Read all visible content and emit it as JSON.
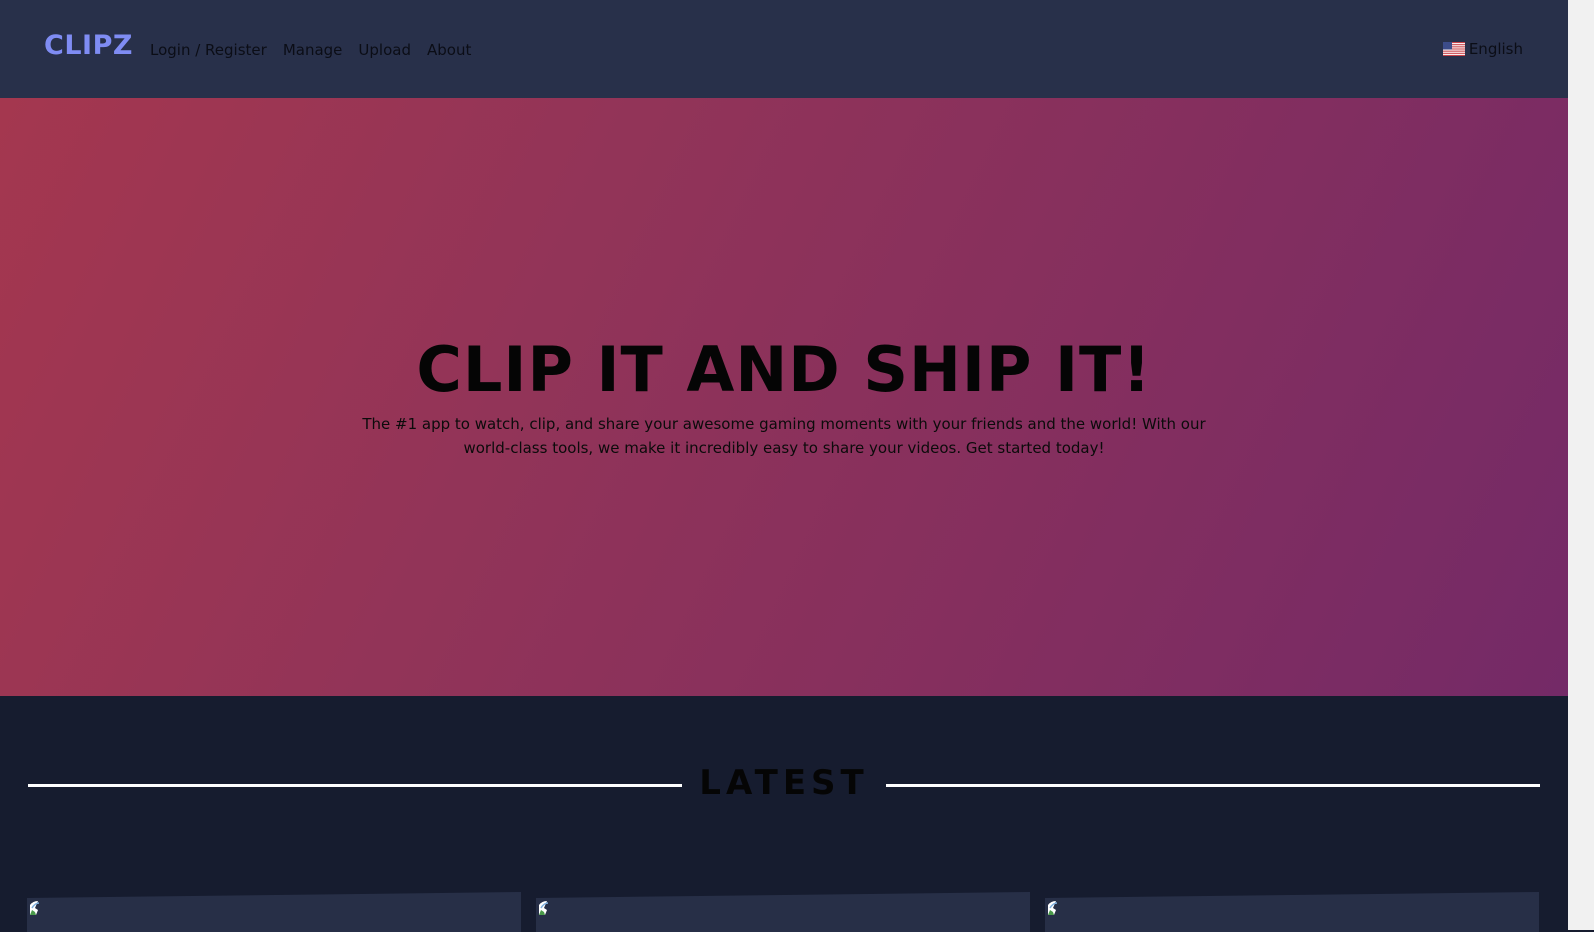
{
  "nav": {
    "brand": "CLIPZ",
    "links": [
      "Login / Register",
      "Manage",
      "Upload",
      "About"
    ],
    "language": "English",
    "language_flag_icon": "us-flag-icon"
  },
  "hero": {
    "title": "CLIP IT AND SHIP IT!",
    "subtitle": "The #1 app to watch, clip, and share your awesome gaming moments with your friends and the world! With our world-class tools, we make it incredibly easy to share your videos. Get started today!"
  },
  "latest": {
    "title": "LATEST",
    "cards": [
      {
        "image_icon": "broken-image-icon"
      },
      {
        "image_icon": "broken-image-icon"
      },
      {
        "image_icon": "broken-image-icon"
      }
    ]
  },
  "colors": {
    "nav_bg": "#28304a",
    "brand": "#7f8cf3",
    "hero_gradient_start": "#a4374f",
    "hero_gradient_end": "#742a67",
    "page_bg": "#161c2f"
  }
}
